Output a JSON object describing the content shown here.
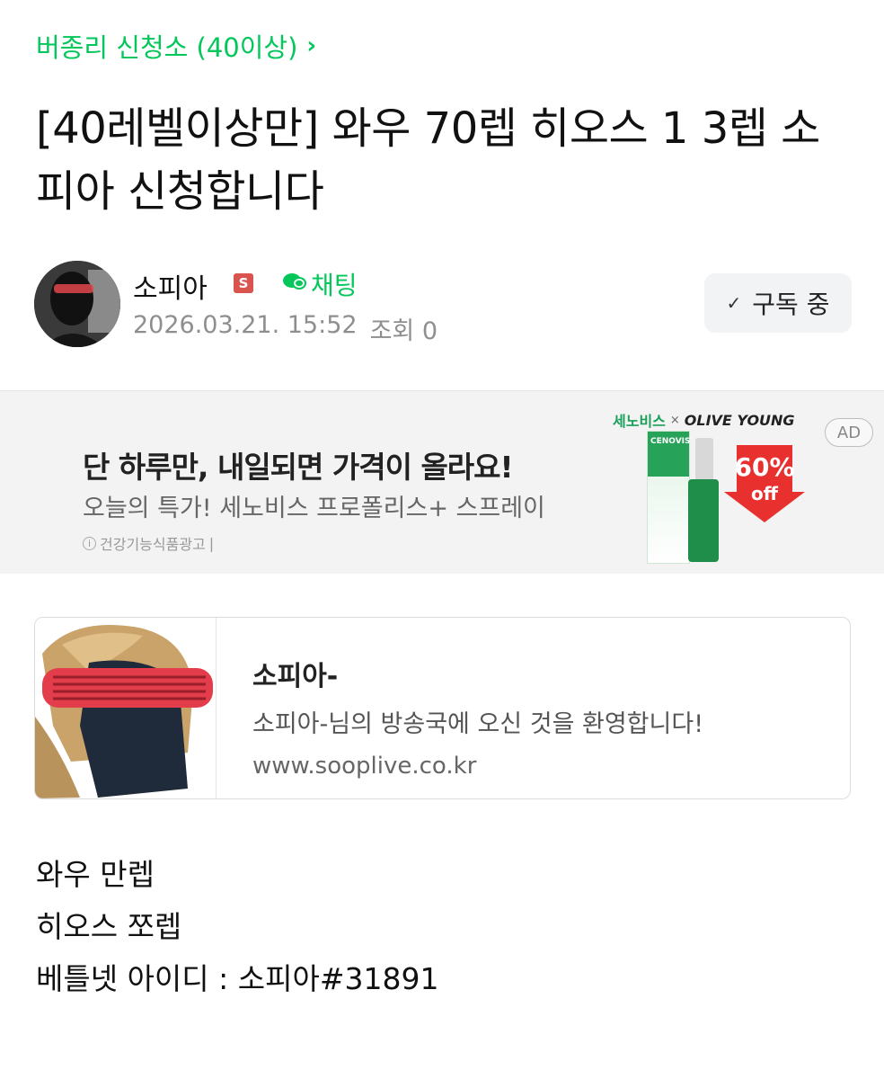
{
  "board": {
    "name": "버종리 신청소 (40이상)",
    "chevron": "›"
  },
  "post": {
    "title": "[40레벨이상만] 와우 70렙 히오스 1 3렙 소피아 신청합니다",
    "author": "소피아",
    "staff_badge": "S",
    "chat_label": "채팅",
    "date": "2026.03.21. 15:52",
    "views": "조회 0",
    "subscribe_label": "구독 중",
    "body_lines": [
      "와우 만렙",
      "히오스 쪼렙",
      "베틀넷 아이디 : 소피아#31891"
    ]
  },
  "ad": {
    "headline": "단 하루만, 내일되면 가격이 올라요!",
    "sub": "오늘의 특가! 세노비스 프로폴리스+ 스프레이",
    "note": "건강기능식품광고",
    "brand1": "세노비스",
    "brand_x": "×",
    "brand2": "OLIVE YOUNG",
    "tag": "AD",
    "discount_pct": "60%",
    "discount_off": "off",
    "product_label": "CENOVIS"
  },
  "link_card": {
    "title": "소피아-",
    "description": "소피아-님의 방송국에 오신 것을 환영합니다!",
    "url": "www.sooplive.co.kr"
  },
  "colors": {
    "accent": "#03c75a",
    "badge": "#d9534f",
    "sale": "#e8312f"
  }
}
